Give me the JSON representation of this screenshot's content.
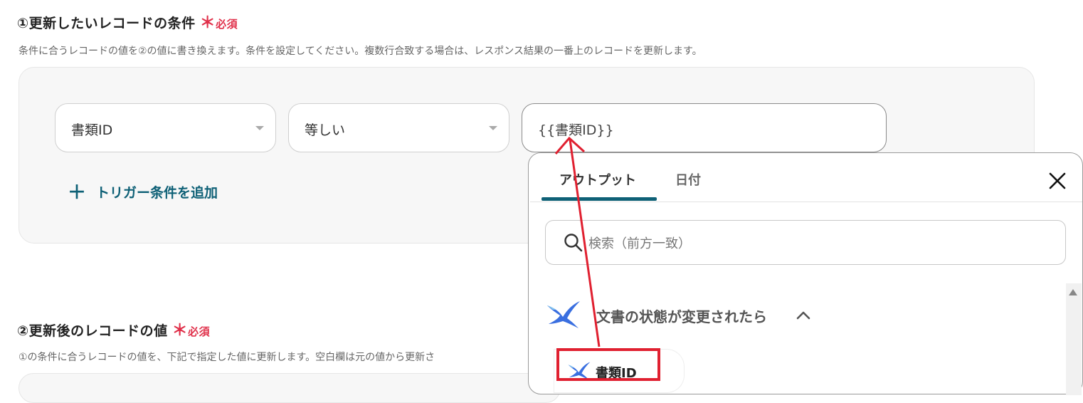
{
  "section1": {
    "title": "①更新したいレコードの条件",
    "required_mark": "＊",
    "required_text": "必須",
    "description": "条件に合うレコードの値を②の値に書き換えます。条件を設定してください。複数行合致する場合は、レスポンス結果の一番上のレコードを更新します。",
    "condition": {
      "field_select": "書類ID",
      "operator_select": "等しい",
      "value_input": "{{書類ID}}"
    },
    "add_condition_label": "トリガー条件を追加",
    "add_condition_icon": "plus-icon"
  },
  "section2": {
    "title": "②更新後のレコードの値",
    "required_mark": "＊",
    "required_text": "必須",
    "description": "①の条件に合うレコードの値を、下記で指定した値に更新します。空白欄は元の値から更新さ"
  },
  "popup": {
    "tabs": [
      {
        "label": "アウトプット",
        "active": true
      },
      {
        "label": "日付",
        "active": false
      }
    ],
    "close_icon": "close-icon",
    "search_placeholder": "検索（前方一致）",
    "group": {
      "title": "文書の状態が変更されたら",
      "icon": "bird-logo-icon",
      "chevron": "chevron-up-icon"
    },
    "items": [
      {
        "label": "書類ID",
        "icon": "bird-logo-icon"
      }
    ]
  },
  "colors": {
    "accent": "#0e6076",
    "required": "#e0304a",
    "annotation": "#e02030",
    "panel_bg": "#f7f7f7",
    "logo_blue": "#3a6fe0"
  }
}
